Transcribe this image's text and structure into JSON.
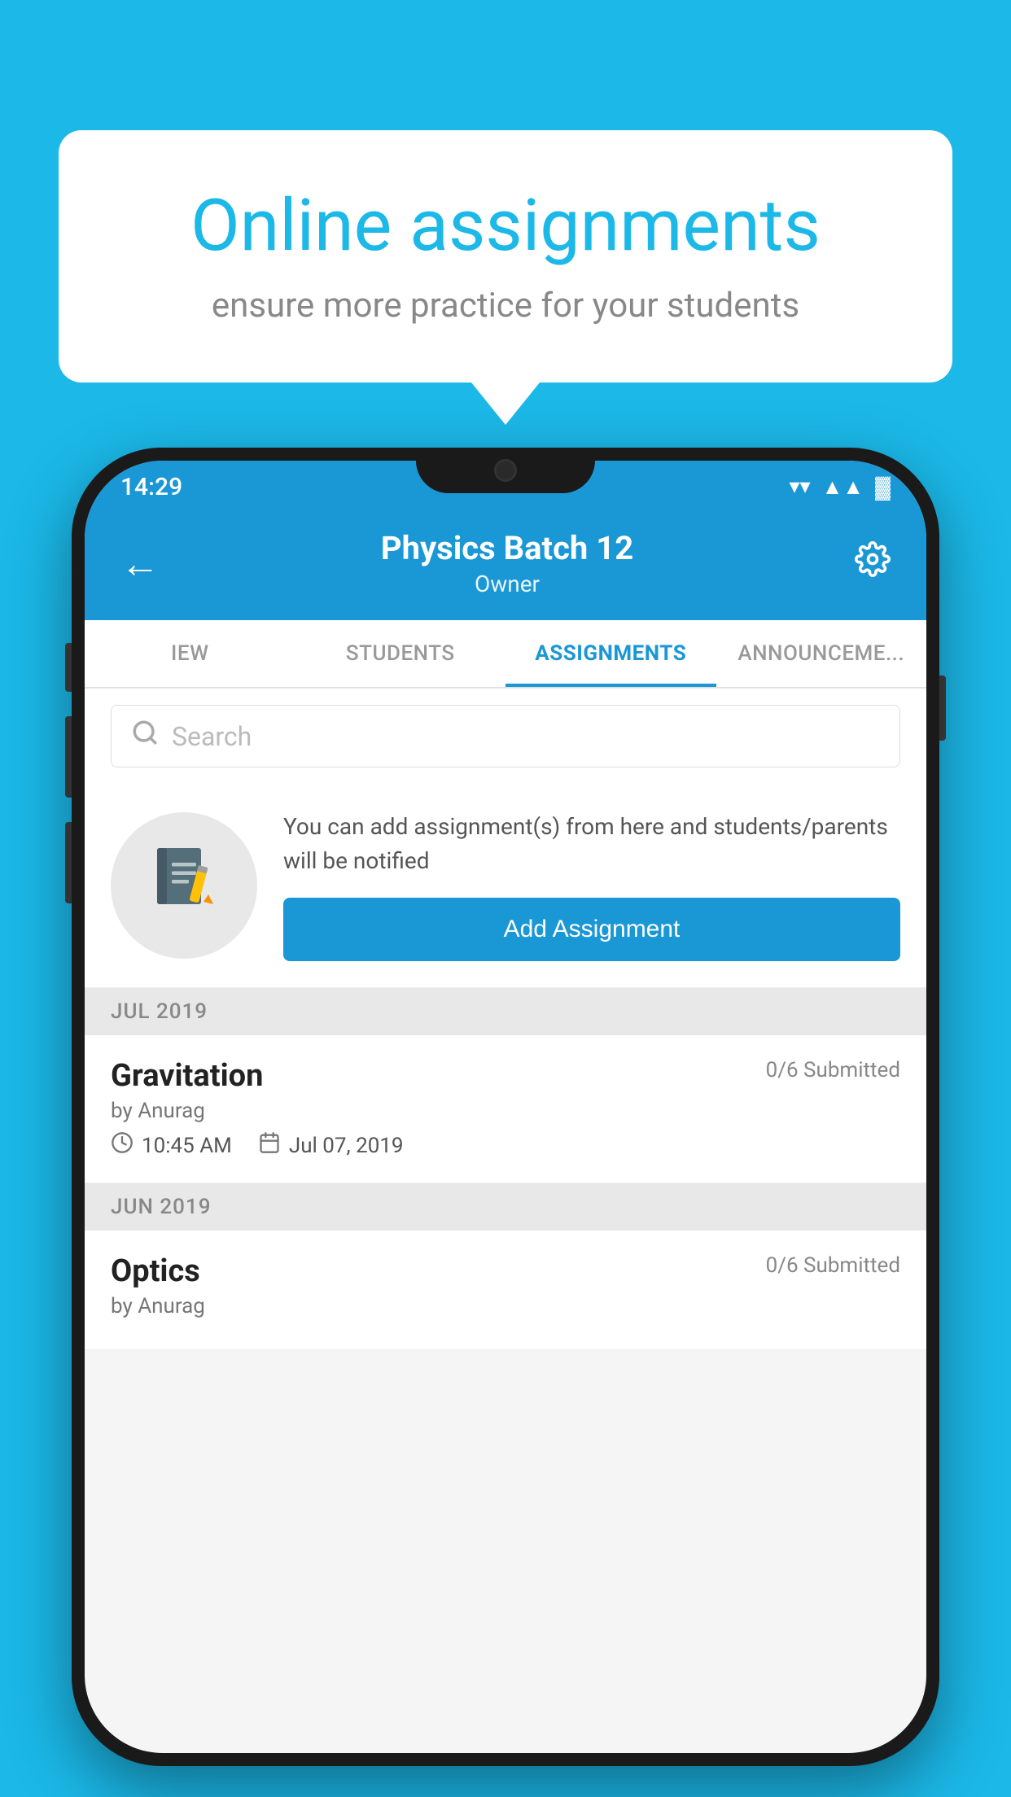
{
  "background_color": "#1BB8E8",
  "speech_bubble": {
    "title": "Online assignments",
    "subtitle": "ensure more practice for your students"
  },
  "status_bar": {
    "time": "14:29",
    "wifi_icon": "wifi",
    "signal_icon": "signal",
    "battery_icon": "battery"
  },
  "header": {
    "back_label": "←",
    "title": "Physics Batch 12",
    "subtitle": "Owner",
    "settings_icon": "gear"
  },
  "tabs": [
    {
      "label": "IEW",
      "active": false
    },
    {
      "label": "STUDENTS",
      "active": false
    },
    {
      "label": "ASSIGNMENTS",
      "active": true
    },
    {
      "label": "ANNOUNCEMENTS",
      "active": false
    }
  ],
  "search": {
    "placeholder": "Search"
  },
  "add_assignment_section": {
    "icon_label": "notebook",
    "info_text": "You can add assignment(s) from here and students/parents will be notified",
    "button_label": "Add Assignment"
  },
  "sections": [
    {
      "header": "JUL 2019",
      "items": [
        {
          "name": "Gravitation",
          "submitted": "0/6 Submitted",
          "by": "by Anurag",
          "time": "10:45 AM",
          "date": "Jul 07, 2019"
        }
      ]
    },
    {
      "header": "JUN 2019",
      "items": [
        {
          "name": "Optics",
          "submitted": "0/6 Submitted",
          "by": "by Anurag",
          "time": "",
          "date": ""
        }
      ]
    }
  ]
}
